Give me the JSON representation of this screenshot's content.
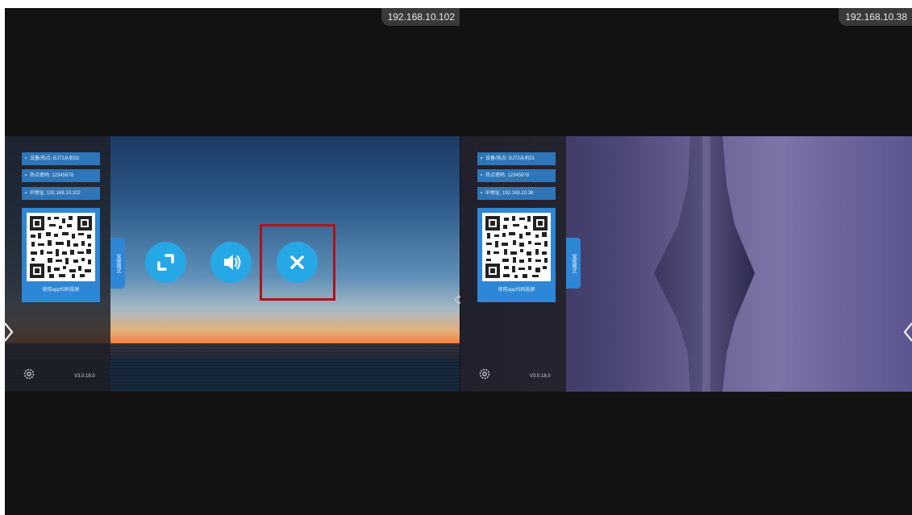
{
  "left_pane": {
    "ip": "192.168.10.102",
    "info": [
      "设备/热点: BJ72从机02",
      "热点密码: 12345678",
      "IP地址: 192.168.10.102"
    ],
    "qr_caption": "使用app扫码投屏",
    "mode_tab": "常规模式",
    "version": "V3.0.18.0"
  },
  "right_pane": {
    "ip": "192.168.10.38",
    "info": [
      "设备/热点: BJ72从机01",
      "热点密码: 12345678",
      "IP地址: 192.168.10.38"
    ],
    "qr_caption": "使用app扫码投屏",
    "mode_tab": "常规模式",
    "version": "V3.0.18.0"
  },
  "controls": {
    "fullscreen": "fullscreen-icon",
    "volume": "volume-icon",
    "close": "close-icon"
  },
  "colors": {
    "accent": "#26a8e6",
    "panel_blue": "#2e86d6",
    "highlight": "#b01217"
  }
}
